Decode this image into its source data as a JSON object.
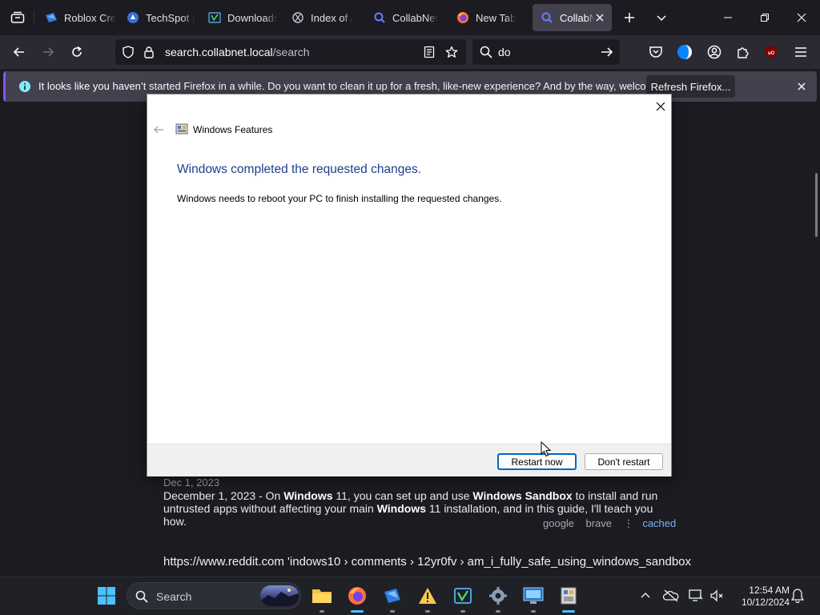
{
  "browser": {
    "tabs": [
      {
        "label": "Roblox Cre",
        "icon": "roblox-icon"
      },
      {
        "label": "TechSpot |",
        "icon": "techspot-icon"
      },
      {
        "label": "Downloads",
        "icon": "download-icon"
      },
      {
        "label": "Index of /",
        "icon": "folder-icon"
      },
      {
        "label": "CollabNet",
        "icon": "collabnet-search-icon"
      },
      {
        "label": "New Tab",
        "icon": "firefox-icon"
      },
      {
        "label": "CollabN",
        "icon": "collabnet-search-icon",
        "active": true
      }
    ],
    "url_host": "search.collabnet.local",
    "url_path": "/search",
    "search_text": "do",
    "notification": {
      "text": "It looks like you haven’t started Firefox in a while. Do you want to clean it up for a fresh, like-new experience? And by the way, welcome back!",
      "button": "Refresh Firefox..."
    }
  },
  "page": {
    "result_date": "Dec 1, 2023",
    "result_snippet_parts": [
      {
        "t": "December 1, 2023 - On ",
        "b": false
      },
      {
        "t": "Windows",
        "b": true
      },
      {
        "t": " 11, you can set up and use ",
        "b": false
      },
      {
        "t": "Windows Sandbox",
        "b": true
      },
      {
        "t": " to install and run untrusted apps without affecting your main ",
        "b": false
      },
      {
        "t": "Windows",
        "b": true
      },
      {
        "t": " 11 installation, and in this guide, I'll teach you how.",
        "b": false
      }
    ],
    "meta_google": "google",
    "meta_brave": "brave",
    "meta_sep": "⋮",
    "meta_cached": "cached",
    "next_url": "https://www.reddit.com  'indows10 › comments › 12yr0fv › am_i_fully_safe_using_windows_sandbox"
  },
  "dialog": {
    "app_title": "Windows Features",
    "heading": "Windows completed the requested changes.",
    "body": "Windows needs to reboot your PC to finish installing the requested changes.",
    "restart_now": "Restart now",
    "dont_restart": "Don't restart"
  },
  "taskbar": {
    "search_placeholder": "Search",
    "time": "12:54 AM",
    "date": "10/12/2024"
  },
  "colors": {
    "accent": "#0067c0",
    "heading_blue": "#1e3f8a",
    "firefox_purple": "#8a54f0",
    "win_blue": "#4cc2ff"
  }
}
